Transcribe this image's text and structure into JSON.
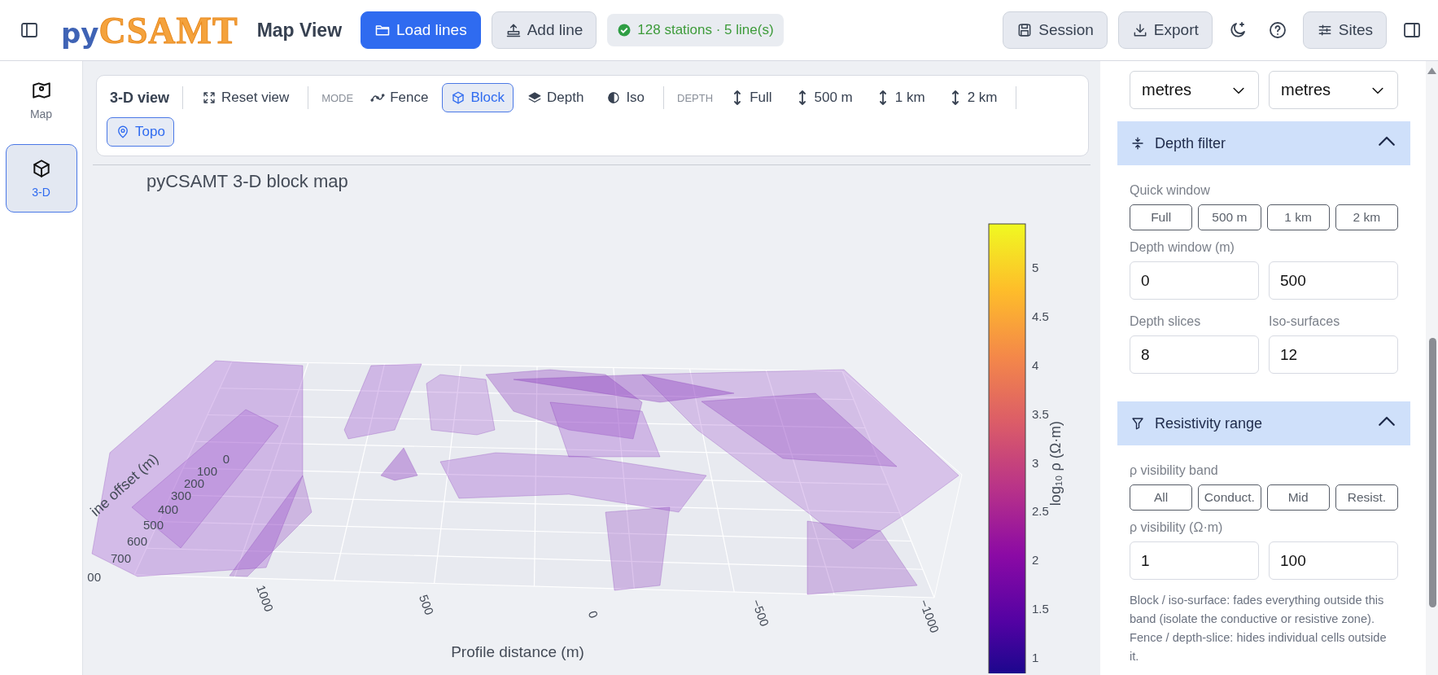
{
  "topbar": {
    "logo_prefix": "py",
    "logo_name": "CSAMT",
    "title": "Map View",
    "actions": [
      {
        "label": "Load lines",
        "kind": "folder",
        "primary": true
      },
      {
        "label": "Add line",
        "kind": "upload",
        "primary": false
      }
    ],
    "status": "128 stations · 5 line(s)",
    "right": [
      {
        "label": "Session",
        "kind": "save"
      },
      {
        "label": "Export",
        "kind": "download"
      },
      {
        "kind": "moon"
      },
      {
        "kind": "help"
      },
      {
        "label": "Sites",
        "kind": "sliders"
      }
    ]
  },
  "rail": [
    {
      "label": "Map",
      "kind": "map",
      "selected": false
    },
    {
      "label": "3-D",
      "kind": "cube",
      "selected": true
    }
  ],
  "toolbar": {
    "title": "3-D view",
    "reset": "Reset view",
    "mode_label": "MODE",
    "modes": [
      {
        "label": "Fence",
        "kind": "fence",
        "selected": false
      },
      {
        "label": "Block",
        "kind": "cube",
        "selected": true
      },
      {
        "label": "Depth",
        "kind": "layers",
        "selected": false
      },
      {
        "label": "Iso",
        "kind": "half",
        "selected": false
      }
    ],
    "depth_label": "DEPTH",
    "depths": [
      {
        "label": "Full",
        "selected": false
      },
      {
        "label": "500 m",
        "selected": false
      },
      {
        "label": "1 km",
        "selected": false
      },
      {
        "label": "2 km",
        "selected": false
      }
    ],
    "topo": {
      "label": "Topo",
      "on": true
    }
  },
  "plot": {
    "title": "pyCSAMT 3-D block map",
    "x_axis": {
      "title": "Profile distance (m)",
      "ticks": [
        "1000",
        "500",
        "0",
        "−500",
        "−1000"
      ]
    },
    "y_axis": {
      "title": "ine offset (m)",
      "ticks": [
        "0",
        "100",
        "200",
        "300",
        "400",
        "500",
        "600",
        "700",
        "00"
      ]
    },
    "colorbar": {
      "title": "log₁₀ ρ (Ω·m)",
      "ticks": [
        "5",
        "4.5",
        "4",
        "3.5",
        "3",
        "2.5",
        "2",
        "1.5",
        "1"
      ]
    }
  },
  "panel": {
    "selects": [
      "metres",
      "metres"
    ],
    "sections": [
      {
        "title": "Depth filter",
        "kind": "compress",
        "expanded": true,
        "rows": [
          {
            "kind": "label",
            "texts": [
              "Quick window"
            ]
          },
          {
            "kind": "chips",
            "texts": [
              "Full",
              "500 m",
              "1 km",
              "2 km"
            ]
          },
          {
            "kind": "label",
            "texts": [
              "Depth window (m)"
            ]
          },
          {
            "kind": "inputs",
            "texts": [
              "0",
              "500"
            ]
          },
          {
            "kind": "label",
            "texts": [
              "Depth slices",
              "Iso-surfaces"
            ]
          },
          {
            "kind": "inputs",
            "texts": [
              "8",
              "12"
            ]
          }
        ]
      },
      {
        "title": "Resistivity range",
        "kind": "filter",
        "expanded": true,
        "rows": [
          {
            "kind": "label",
            "texts": [
              "ρ visibility band"
            ]
          },
          {
            "kind": "chips",
            "texts": [
              "All",
              "Conduct.",
              "Mid",
              "Resist."
            ]
          },
          {
            "kind": "label",
            "texts": [
              "ρ visibility (Ω·m)"
            ]
          },
          {
            "kind": "inputs",
            "texts": [
              "1",
              "100"
            ]
          },
          {
            "kind": "note",
            "texts": [
              "Block / iso-surface: fades everything outside this band (isolate the conductive or resistive zone). Fence / depth-slice: hides individual cells outside it."
            ]
          }
        ]
      }
    ]
  }
}
